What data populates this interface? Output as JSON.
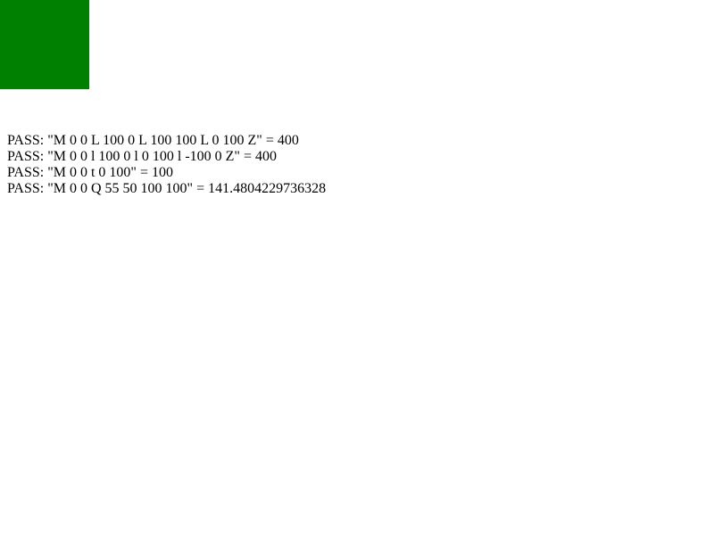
{
  "square": {
    "color": "#008000"
  },
  "results": [
    "PASS: \"M 0 0 L 100 0 L 100 100 L 0 100 Z\" = 400",
    "PASS: \"M 0 0 l 100 0 l 0 100 l -100 0 Z\" = 400",
    "PASS: \"M 0 0 t 0 100\" = 100",
    "PASS: \"M 0 0 Q 55 50 100 100\" = 141.4804229736328"
  ]
}
